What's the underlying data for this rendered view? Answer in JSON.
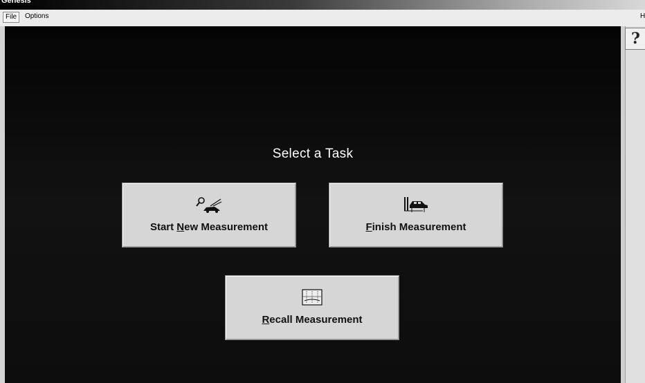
{
  "window": {
    "title": "Genesis"
  },
  "menubar": {
    "file": "File",
    "options": "Options",
    "help": "He"
  },
  "help_button": {
    "label": "?"
  },
  "main": {
    "prompt": "Select a Task",
    "buttons": {
      "start_new": {
        "prefix": "Start ",
        "mnemonic": "N",
        "suffix": "ew Measurement",
        "icon": "magnifier-car-icon"
      },
      "finish": {
        "prefix": "",
        "mnemonic": "F",
        "suffix": "inish Measurement",
        "icon": "car-lift-icon"
      },
      "recall": {
        "prefix": "",
        "mnemonic": "R",
        "suffix": "ecall Measurement",
        "icon": "measurement-chart-icon"
      }
    }
  }
}
